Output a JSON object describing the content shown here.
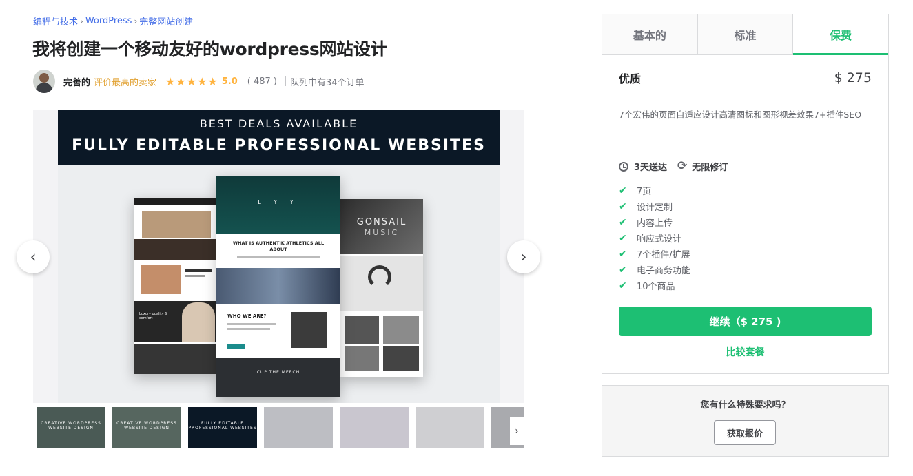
{
  "breadcrumb": [
    "编程与技术",
    "WordPress",
    "完整网站创建"
  ],
  "gig": {
    "title": "我将创建一个移动友好的wordpress网站设计"
  },
  "seller": {
    "name": "完善的",
    "level": "评价最高的卖家",
    "rating": "5.0",
    "stars": 5,
    "reviews": "( 487 )",
    "queue": "队列中有34个订单"
  },
  "gallery": {
    "banner_top": "BEST DEALS AVAILABLE",
    "banner_main": "FULLY EDITABLE PROFESSIONAL WEBSITES",
    "mock_center_heading": "WHAT IS AUTHENTIK ATHLETICS ALL ABOUT",
    "mock_center_sub": "WHO WE ARE?",
    "mock_center_footer": "CUP THE MERCH",
    "mock_right_title": "GONSAIL",
    "mock_right_sub": "MUSIC",
    "mock_left_caption": "Luxury quality & comfort",
    "prev_icon": "chevron-left-icon",
    "next_icon": "chevron-right-icon"
  },
  "thumbnails": [
    {
      "label": "CREATIVE WORDPRESS WEBSITE DESIGN",
      "color": "#4a5a55"
    },
    {
      "label": "CREATIVE WORDPRESS WEBSITE DESIGN",
      "color": "#56665f"
    },
    {
      "label": "FULLY EDITABLE PROFESSIONAL WEBSITES",
      "color": "#0b1826"
    },
    {
      "label": "",
      "color": "#bdbec3"
    },
    {
      "label": "",
      "color": "#c9c6cf"
    },
    {
      "label": "",
      "color": "#cfcfd2"
    },
    {
      "label": "",
      "color": "#a9aaae"
    }
  ],
  "packages": {
    "tabs": [
      "基本的",
      "标准",
      "保费"
    ],
    "active_tab": 2,
    "name": "优质",
    "price": "$ 275",
    "description": "7个宏伟的页面自适应设计高清图标和图形视差效果7+插件SEO",
    "delivery": "3天送达",
    "revisions": "无限修订",
    "features": [
      "7页",
      "设计定制",
      "内容上传",
      "响应式设计",
      "7个插件/扩展",
      "电子商务功能",
      "10个商品"
    ],
    "continue_label": "继续（$ 275 )",
    "compare_label": "比较套餐"
  },
  "contact": {
    "question": "您有什么特殊要求吗？",
    "button": "获取报价"
  },
  "colors": {
    "accent": "#1dbf73",
    "star": "#ffb33e",
    "link": "#446ee7",
    "level": "#e1a02f"
  }
}
